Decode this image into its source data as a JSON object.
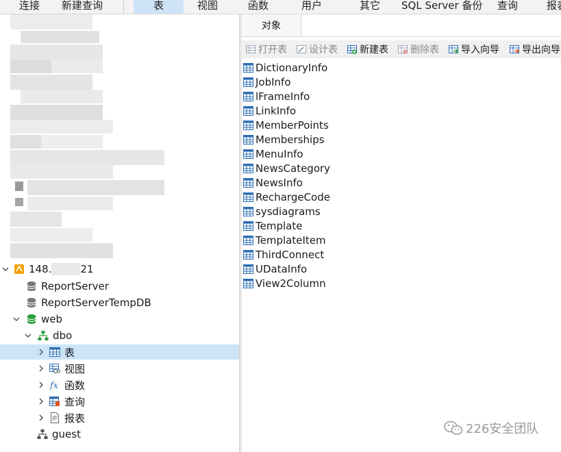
{
  "menu": {
    "items": [
      "连接",
      "新建查询",
      "表",
      "视图",
      "函数",
      "用户",
      "其它",
      "SQL Server 备份",
      "查询",
      "报表"
    ],
    "active": "表"
  },
  "tree": {
    "server_label": "148.",
    "server_suffix": "21",
    "nodes": [
      {
        "label": "ReportServer"
      },
      {
        "label": "ReportServerTempDB"
      },
      {
        "label": "web"
      },
      {
        "label": "dbo"
      },
      {
        "label": "表"
      },
      {
        "label": "视图"
      },
      {
        "label": "函数"
      },
      {
        "label": "查询"
      },
      {
        "label": "报表"
      },
      {
        "label": "guest"
      }
    ]
  },
  "right": {
    "tab_label": "对象",
    "toolbar": {
      "open": "打开表",
      "design": "设计表",
      "new": "新建表",
      "delete": "删除表",
      "import": "导入向导",
      "export": "导出向导"
    },
    "tables": [
      "DictionaryInfo",
      "JobInfo",
      "lFrameInfo",
      "LinkInfo",
      "MemberPoints",
      "Memberships",
      "MenuInfo",
      "NewsCategory",
      "NewsInfo",
      "RechargeCode",
      "sysdiagrams",
      "Template",
      "TemplateItem",
      "ThirdConnect",
      "UDataInfo",
      "View2Column"
    ]
  },
  "watermark": {
    "text": "226安全团队"
  },
  "colors": {
    "selection": "#cce4f7",
    "db_green": "#2e9e3e",
    "schema_green": "#2e9e3e",
    "table_blue": "#2f6fb3",
    "server_orange": "#f0a30a"
  }
}
